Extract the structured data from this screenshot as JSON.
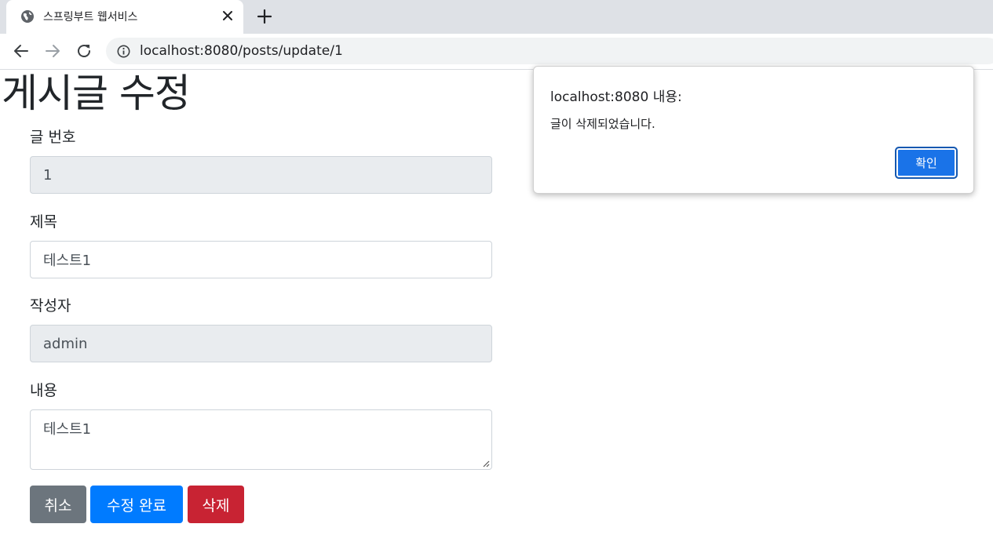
{
  "browser": {
    "tab": {
      "title": "스프링부트 웹서비스",
      "favicon": "globe-icon",
      "close_icon": "close-icon"
    },
    "new_tab_icon": "plus-icon",
    "nav": {
      "back_icon": "back-arrow-icon",
      "forward_icon": "forward-arrow-icon",
      "reload_icon": "reload-icon"
    },
    "omnibox": {
      "info_icon": "info-icon",
      "url": "localhost:8080/posts/update/1"
    }
  },
  "page": {
    "title": "게시글 수정",
    "form": {
      "id": {
        "label": "글 번호",
        "value": "1"
      },
      "title": {
        "label": "제목",
        "value": "테스트1"
      },
      "author": {
        "label": "작성자",
        "value": "admin"
      },
      "content": {
        "label": "내용",
        "value": "테스트1"
      }
    },
    "buttons": {
      "cancel": "취소",
      "save": "수정 완료",
      "delete": "삭제"
    }
  },
  "dialog": {
    "title": "localhost:8080 내용:",
    "message": "글이 삭제되었습니다.",
    "ok": "확인"
  },
  "colors": {
    "primary": "#007bff",
    "secondary": "#6c757d",
    "danger": "#c82333",
    "dialog_button": "#1a73e8"
  }
}
